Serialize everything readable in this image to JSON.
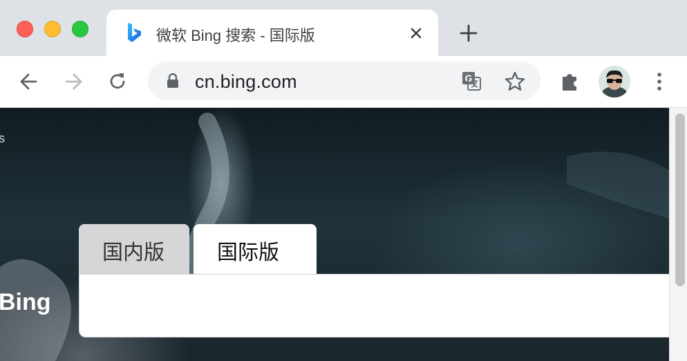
{
  "window": {
    "tab_title": "微软 Bing 搜索 - 国际版",
    "favicon": "bing-icon"
  },
  "toolbar": {
    "url": "cn.bing.com",
    "icons": [
      "back-icon",
      "forward-icon",
      "reload-icon",
      "lock-icon",
      "translate-icon",
      "star-icon",
      "extensions-icon",
      "avatar",
      "menu-icon"
    ]
  },
  "page": {
    "brand": "Bing",
    "tabs": [
      {
        "label": "国内版",
        "active": false
      },
      {
        "label": "国际版",
        "active": true
      }
    ],
    "search_value": ""
  },
  "colors": {
    "titlebar": "#dee1e6",
    "accent_bing": "#1a8ae8"
  }
}
